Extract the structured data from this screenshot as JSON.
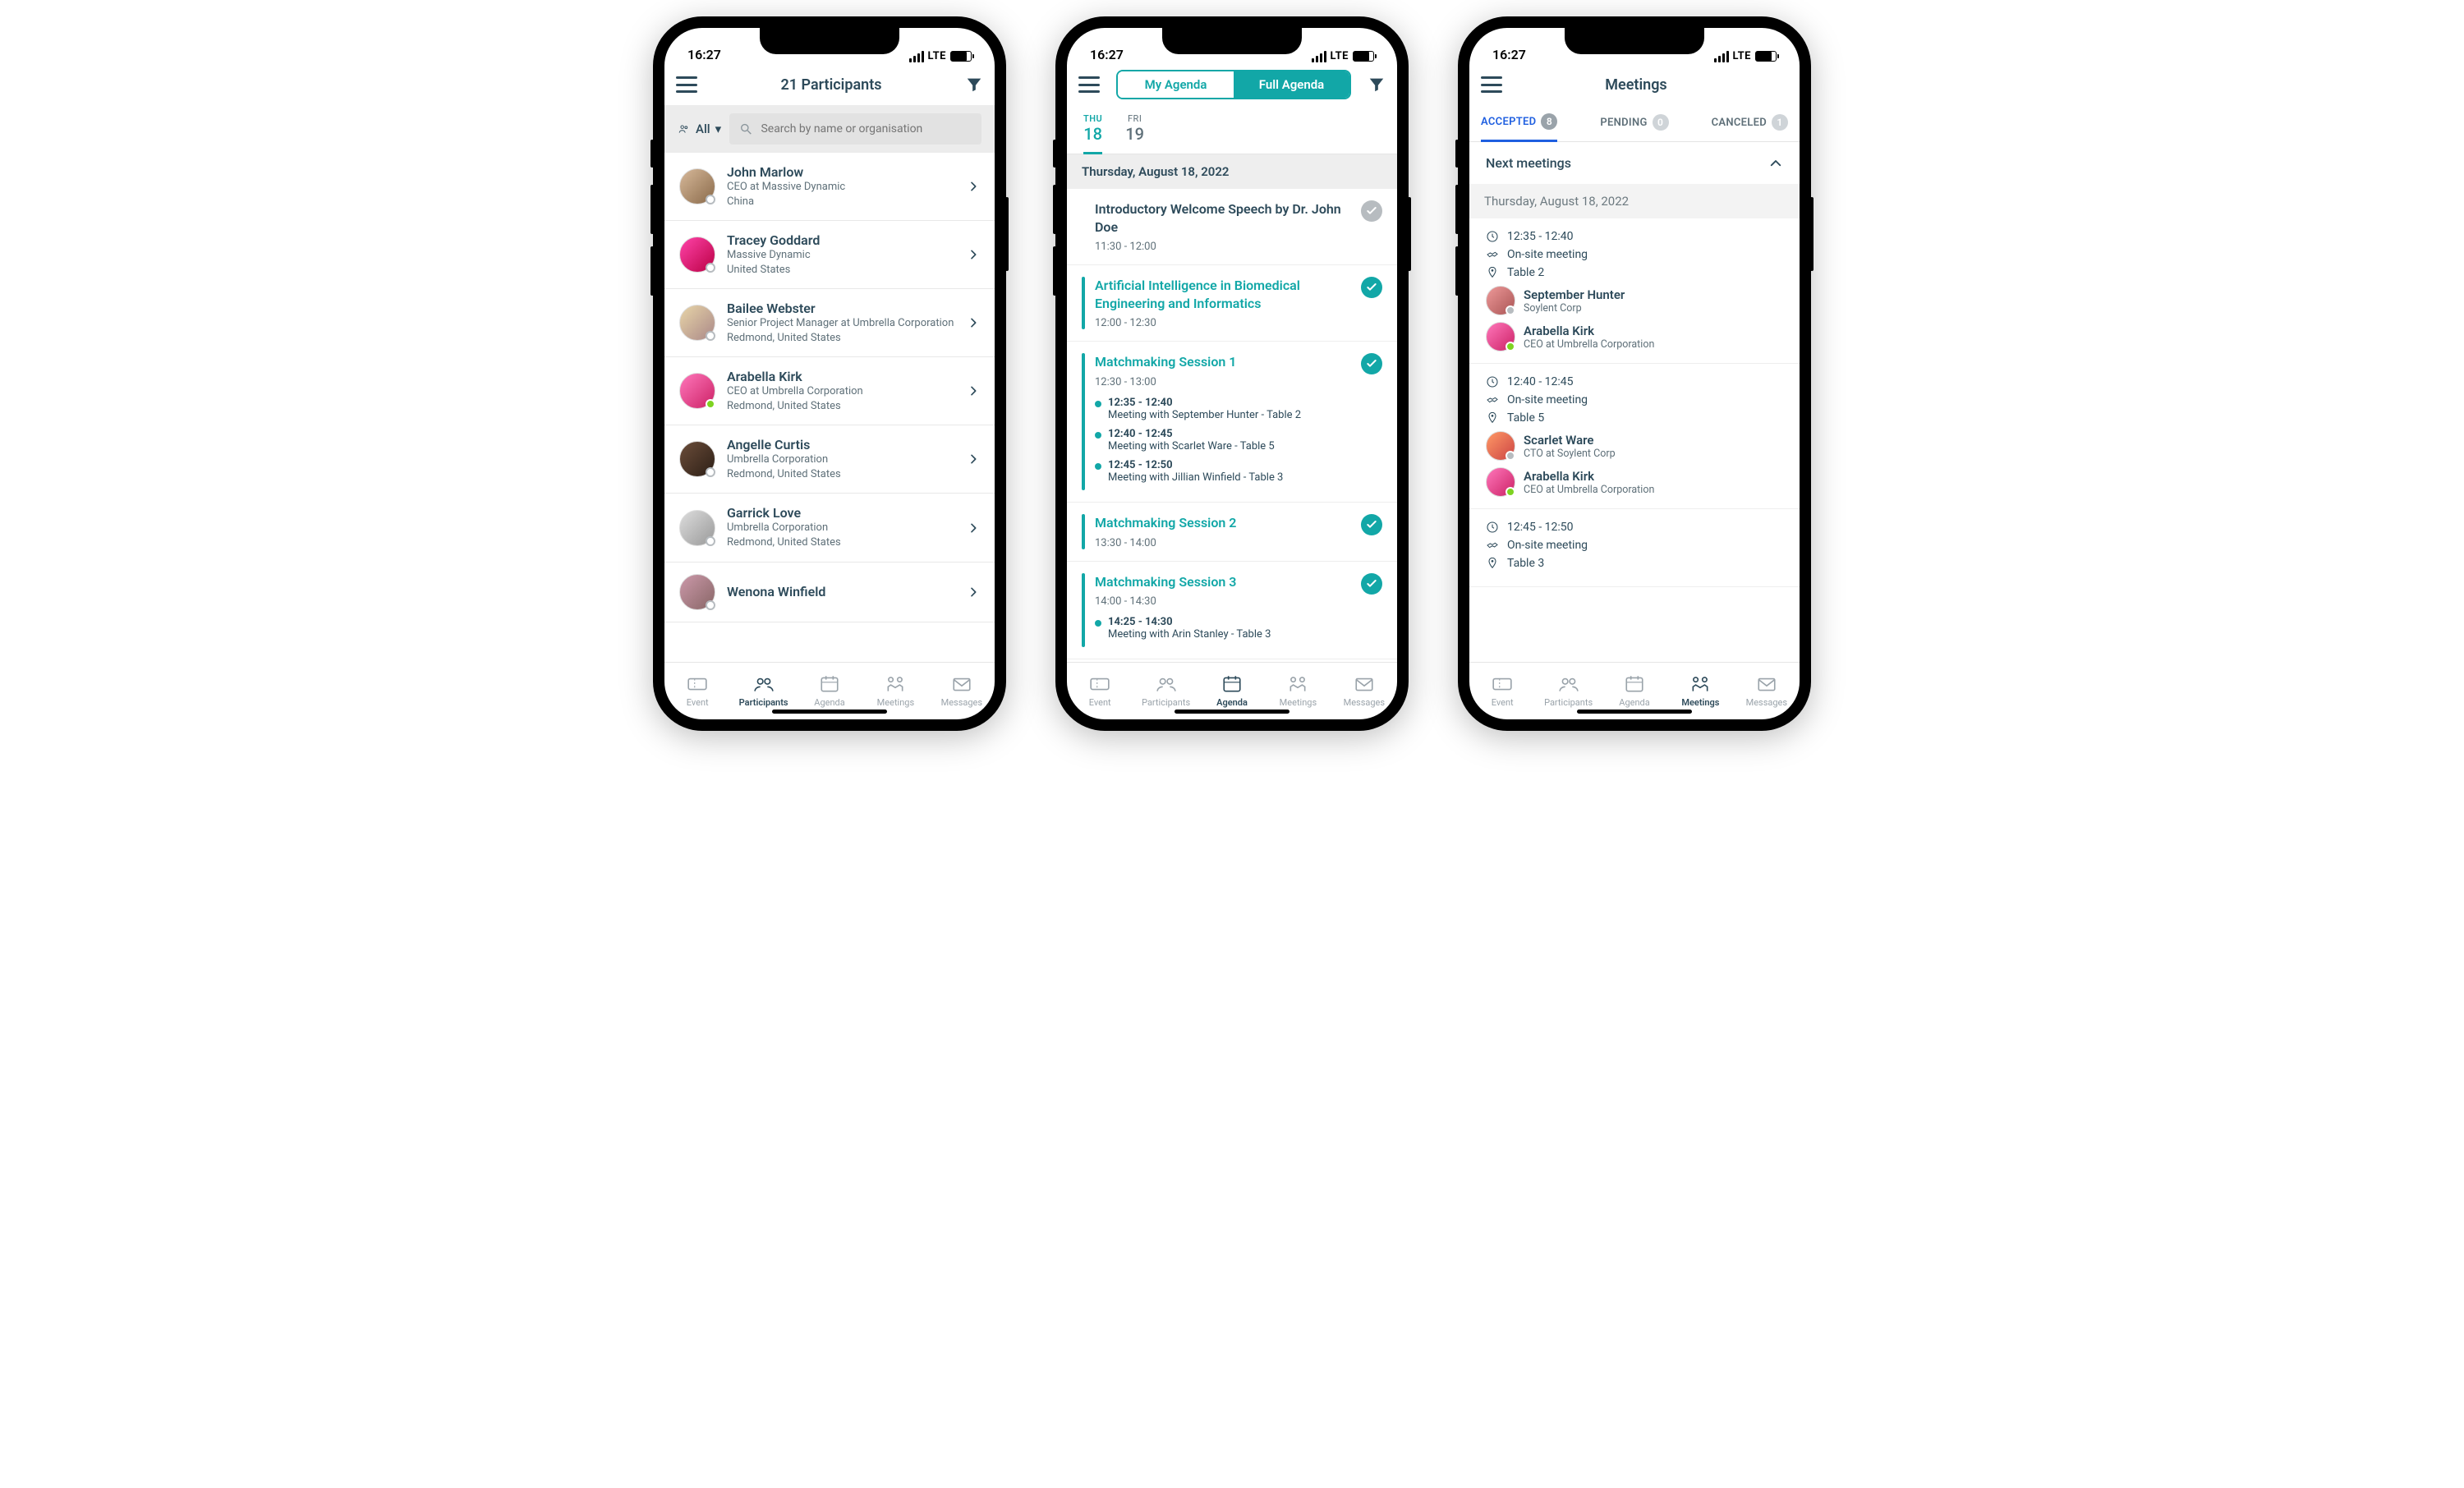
{
  "status": {
    "time": "16:27",
    "net": "LTE"
  },
  "nav_labels": {
    "event": "Event",
    "participants": "Participants",
    "agenda": "Agenda",
    "meetings": "Meetings",
    "messages": "Messages"
  },
  "participants": {
    "title": "21 Participants",
    "filter_all": "All",
    "search_placeholder": "Search by name or organisation",
    "list": [
      {
        "name": "John Marlow",
        "sub": "CEO at Massive Dynamic",
        "loc": "China",
        "status": "none",
        "av": "av-a"
      },
      {
        "name": "Tracey Goddard",
        "sub": "Massive Dynamic",
        "loc": "United States",
        "status": "none",
        "av": "av-b"
      },
      {
        "name": "Bailee Webster",
        "sub": "Senior Project Manager at Umbrella Corporation",
        "loc": "Redmond, United States",
        "status": "none",
        "av": "av-c"
      },
      {
        "name": "Arabella Kirk",
        "sub": "CEO at Umbrella Corporation",
        "loc": "Redmond, United States",
        "status": "online",
        "av": "av-d"
      },
      {
        "name": "Angelle Curtis",
        "sub": "Umbrella Corporation",
        "loc": "Redmond, United States",
        "status": "none",
        "av": "av-e"
      },
      {
        "name": "Garrick Love",
        "sub": "Umbrella Corporation",
        "loc": "Redmond, United States",
        "status": "none",
        "av": "av-f"
      },
      {
        "name": "Wenona Winfield",
        "sub": "",
        "loc": "",
        "status": "none",
        "av": "av-g"
      }
    ]
  },
  "agenda": {
    "seg": {
      "my": "My Agenda",
      "full": "Full Agenda",
      "active": "full"
    },
    "days": [
      {
        "dow": "THU",
        "num": "18",
        "on": true
      },
      {
        "dow": "FRI",
        "num": "19",
        "on": false
      }
    ],
    "day_header": "Thursday, August 18, 2022",
    "items": [
      {
        "title": "Introductory Welcome Speech by Dr. John Doe",
        "time": "11:30 - 12:00",
        "state": "done-grey",
        "subs": []
      },
      {
        "title": "Artificial Intelligence in Biomedical Engineering and Informatics",
        "time": "12:00 - 12:30",
        "state": "accepted",
        "subs": []
      },
      {
        "title": "Matchmaking Session 1",
        "time": "12:30 - 13:00",
        "state": "accepted",
        "subs": [
          {
            "time": "12:35 - 12:40",
            "text": "Meeting with September Hunter - Table 2"
          },
          {
            "time": "12:40 - 12:45",
            "text": "Meeting with Scarlet Ware - Table 5"
          },
          {
            "time": "12:45 - 12:50",
            "text": "Meeting with Jillian Winfield - Table 3"
          }
        ]
      },
      {
        "title": "Matchmaking Session 2",
        "time": "13:30 - 14:00",
        "state": "accepted",
        "subs": []
      },
      {
        "title": "Matchmaking Session 3",
        "time": "14:00 - 14:30",
        "state": "accepted",
        "subs": [
          {
            "time": "14:25 - 14:30",
            "text": "Meeting with Arin Stanley - Table 3"
          }
        ]
      }
    ]
  },
  "meetings": {
    "title": "Meetings",
    "tabs": [
      {
        "label": "ACCEPTED",
        "count": "8",
        "on": true
      },
      {
        "label": "PENDING",
        "count": "0",
        "on": false
      },
      {
        "label": "CANCELED",
        "count": "1",
        "on": false
      }
    ],
    "section": "Next meetings",
    "day_header": "Thursday, August 18, 2022",
    "cards": [
      {
        "time": "12:35 - 12:40",
        "type": "On-site meeting",
        "loc": "Table 2",
        "att": [
          {
            "name": "September Hunter",
            "sub": "Soylent Corp",
            "av": "av-i",
            "dot": "#b7bcc0"
          },
          {
            "name": "Arabella Kirk",
            "sub": "CEO at Umbrella Corporation",
            "av": "av-d",
            "dot": "#7ed321"
          }
        ]
      },
      {
        "time": "12:40 - 12:45",
        "type": "On-site meeting",
        "loc": "Table 5",
        "att": [
          {
            "name": "Scarlet Ware",
            "sub": "CTO at Soylent Corp",
            "av": "av-h",
            "dot": "#b7bcc0"
          },
          {
            "name": "Arabella Kirk",
            "sub": "CEO at Umbrella Corporation",
            "av": "av-d",
            "dot": "#7ed321"
          }
        ]
      },
      {
        "time": "12:45 - 12:50",
        "type": "On-site meeting",
        "loc": "Table 3",
        "att": []
      }
    ]
  }
}
